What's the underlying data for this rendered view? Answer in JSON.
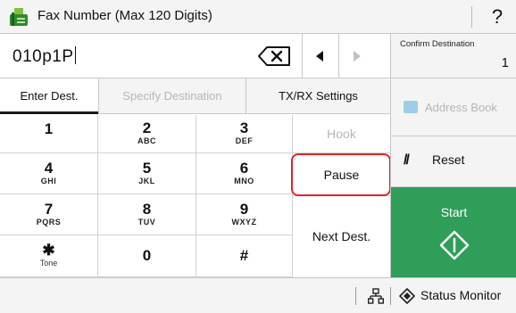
{
  "titlebar": {
    "title": "Fax Number (Max 120 Digits)",
    "help_label": "?"
  },
  "input": {
    "value": "010p1P"
  },
  "confirm_destination": {
    "label": "Confirm Destination",
    "count": "1"
  },
  "tabs": [
    {
      "label": "Enter Dest.",
      "state": "active"
    },
    {
      "label": "Specify Destination",
      "state": "disabled"
    },
    {
      "label": "TX/RX Settings",
      "state": "normal"
    }
  ],
  "keypad": {
    "keys": [
      {
        "digit": "1",
        "letters": ""
      },
      {
        "digit": "2",
        "letters": "ABC"
      },
      {
        "digit": "3",
        "letters": "DEF"
      },
      {
        "digit": "4",
        "letters": "GHI"
      },
      {
        "digit": "5",
        "letters": "JKL"
      },
      {
        "digit": "6",
        "letters": "MNO"
      },
      {
        "digit": "7",
        "letters": "PQRS"
      },
      {
        "digit": "8",
        "letters": "TUV"
      },
      {
        "digit": "9",
        "letters": "WXYZ"
      },
      {
        "digit": "✱",
        "letters": "Tone"
      },
      {
        "digit": "0",
        "letters": ""
      },
      {
        "digit": "#",
        "letters": ""
      }
    ]
  },
  "side_buttons": {
    "hook": "Hook",
    "pause": "Pause",
    "next_dest": "Next Dest."
  },
  "right_panel": {
    "address_book": "Address Book",
    "reset": "Reset",
    "start": "Start"
  },
  "statusbar": {
    "status_monitor": "Status Monitor"
  },
  "colors": {
    "start_green": "#2e9e59",
    "highlight_red": "#e0242b",
    "disabled_gray": "#b6b6b6",
    "panel_gray": "#f4f4f4"
  }
}
